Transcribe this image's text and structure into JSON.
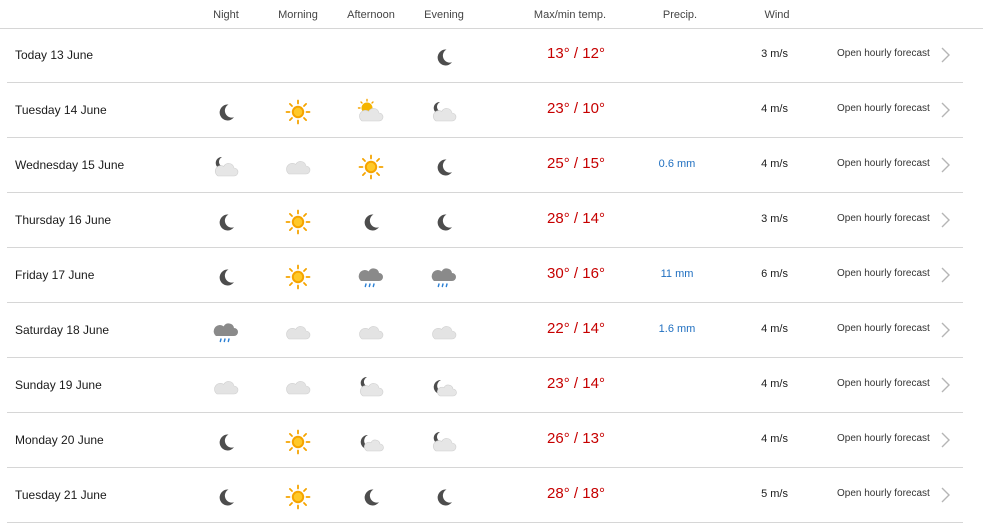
{
  "header": {
    "night": "Night",
    "morning": "Morning",
    "afternoon": "Afternoon",
    "evening": "Evening",
    "temp": "Max/min temp.",
    "precip": "Precip.",
    "wind": "Wind"
  },
  "link_label": "Open hourly forecast",
  "colors": {
    "temp": "#c60000",
    "precip": "#1f6fc0",
    "divider": "#d6d6d6"
  },
  "rows": [
    {
      "date": "Today 13 June",
      "icons": [
        "",
        "",
        "",
        "moon-icon"
      ],
      "max": "13°",
      "min": "12°",
      "precip": "",
      "wind": "3 m/s"
    },
    {
      "date": "Tuesday 14 June",
      "icons": [
        "moon-icon",
        "sun-icon",
        "sun-cloud-icon",
        "moon-cloud-icon"
      ],
      "max": "23°",
      "min": "10°",
      "precip": "",
      "wind": "4 m/s"
    },
    {
      "date": "Wednesday 15 June",
      "icons": [
        "moon-cloud-icon",
        "cloud-icon",
        "sun-icon",
        "moon-icon"
      ],
      "max": "25°",
      "min": "15°",
      "precip": "0.6 mm",
      "wind": "4 m/s"
    },
    {
      "date": "Thursday 16 June",
      "icons": [
        "moon-icon",
        "sun-icon",
        "moon-icon",
        "moon-icon"
      ],
      "max": "28°",
      "min": "14°",
      "precip": "",
      "wind": "3 m/s"
    },
    {
      "date": "Friday 17 June",
      "icons": [
        "moon-icon",
        "sun-icon",
        "rain-cloud-icon",
        "rain-cloud-icon"
      ],
      "max": "30°",
      "min": "16°",
      "precip": "11 mm",
      "wind": "6 m/s"
    },
    {
      "date": "Saturday 18 June",
      "icons": [
        "rain-cloud-icon",
        "cloud-icon",
        "cloud-icon",
        "cloud-icon"
      ],
      "max": "22°",
      "min": "14°",
      "precip": "1.6 mm",
      "wind": "4 m/s"
    },
    {
      "date": "Sunday 19 June",
      "icons": [
        "cloud-icon",
        "cloud-icon",
        "moon-cloud-icon",
        "moon-partly-icon"
      ],
      "max": "23°",
      "min": "14°",
      "precip": "",
      "wind": "4 m/s"
    },
    {
      "date": "Monday 20 June",
      "icons": [
        "moon-icon",
        "sun-icon",
        "moon-partly-icon",
        "moon-cloud-icon"
      ],
      "max": "26°",
      "min": "13°",
      "precip": "",
      "wind": "4 m/s"
    },
    {
      "date": "Tuesday 21 June",
      "icons": [
        "moon-icon",
        "sun-icon",
        "moon-icon",
        "moon-icon"
      ],
      "max": "28°",
      "min": "18°",
      "precip": "",
      "wind": "5 m/s"
    }
  ]
}
